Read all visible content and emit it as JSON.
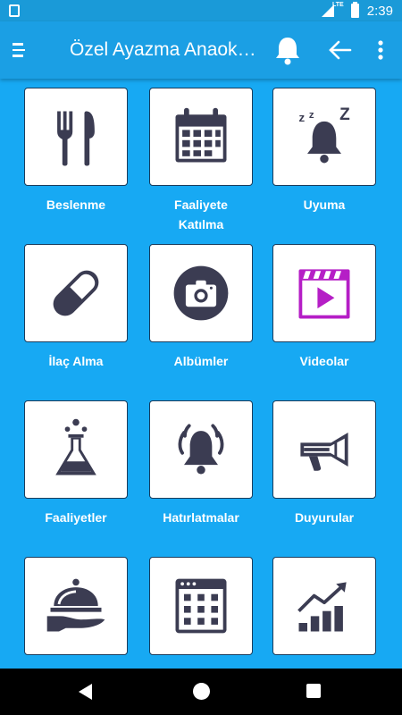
{
  "status_bar": {
    "time": "2:39",
    "network": "LTE"
  },
  "app_bar": {
    "title": "Özel Ayazma Anaokulu"
  },
  "colors": {
    "background": "#17a9f3",
    "app_bar": "#1b9fe4",
    "icon": "#3b3c52",
    "video_accent": "#b51ec6"
  },
  "tiles": [
    {
      "label": "Beslenme",
      "icon": "fork-knife-icon"
    },
    {
      "label": "Faaliyete Katılma",
      "icon": "calendar-icon"
    },
    {
      "label": "Uyuma",
      "icon": "sleeping-bell-icon"
    },
    {
      "label": "İlaç Alma",
      "icon": "pill-icon"
    },
    {
      "label": "Albümler",
      "icon": "camera-icon"
    },
    {
      "label": "Videolar",
      "icon": "video-icon"
    },
    {
      "label": "Faaliyetler",
      "icon": "flask-icon"
    },
    {
      "label": "Hatırlatmalar",
      "icon": "alarm-bell-icon"
    },
    {
      "label": "Duyurular",
      "icon": "megaphone-icon"
    },
    {
      "label": "",
      "icon": "serving-tray-icon"
    },
    {
      "label": "",
      "icon": "schedule-grid-icon"
    },
    {
      "label": "",
      "icon": "growth-chart-icon"
    }
  ]
}
